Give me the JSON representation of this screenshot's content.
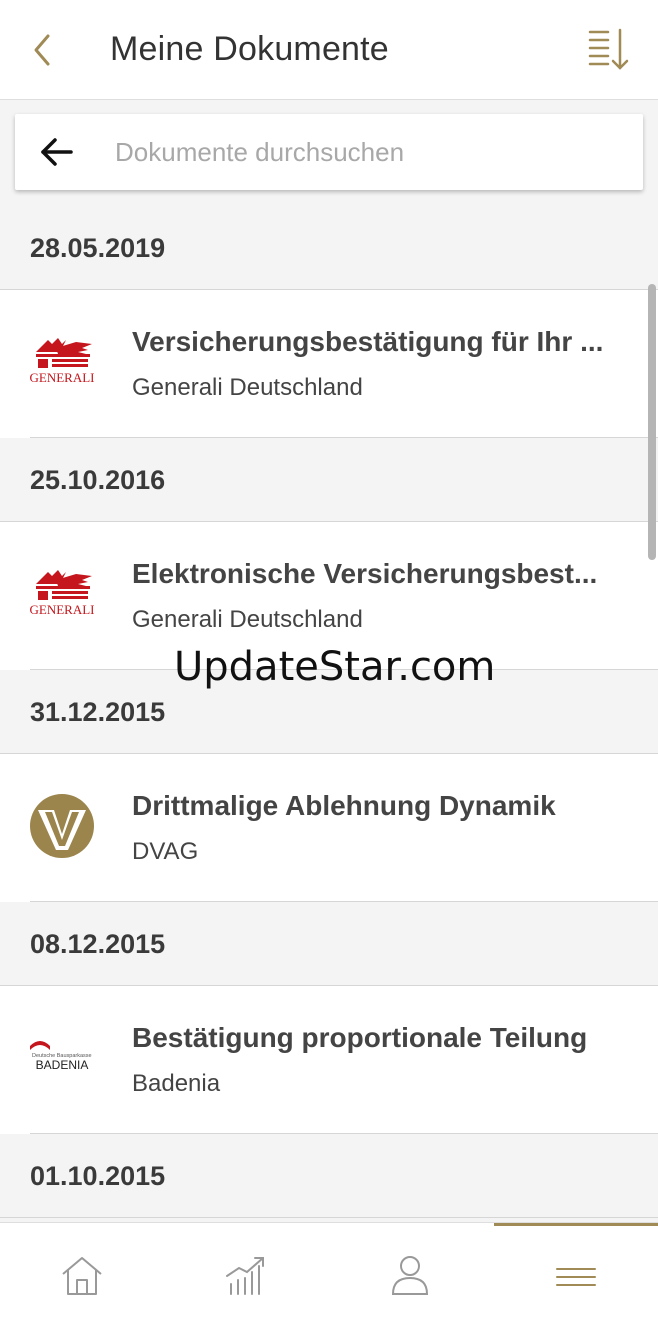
{
  "header": {
    "title": "Meine Dokumente",
    "back_icon": "chevron-left-icon",
    "sort_icon": "sort-list-icon"
  },
  "search": {
    "placeholder": "Dokumente durchsuchen",
    "value": "",
    "back_icon": "arrow-left-icon"
  },
  "colors": {
    "accent": "#a08a55",
    "generali_red": "#c4161c",
    "dvag_gold": "#9b854c",
    "text": "#333333",
    "background": "#f4f4f4"
  },
  "groups": [
    {
      "date": "28.05.2019",
      "items": [
        {
          "title": "Versicherungsbestätigung für Ihr ...",
          "subtitle": "Generali Deutschland",
          "logo": "generali-logo",
          "logo_text": "GENERALI"
        }
      ]
    },
    {
      "date": "25.10.2016",
      "items": [
        {
          "title": "Elektronische Versicherungsbest...",
          "subtitle": "Generali Deutschland",
          "logo": "generali-logo",
          "logo_text": "GENERALI"
        }
      ]
    },
    {
      "date": "31.12.2015",
      "items": [
        {
          "title": "Drittmalige Ablehnung Dynamik",
          "subtitle": "DVAG",
          "logo": "dvag-logo"
        }
      ]
    },
    {
      "date": "08.12.2015",
      "items": [
        {
          "title": "Bestätigung proportionale Teilung",
          "subtitle": "Badenia",
          "logo": "badenia-logo",
          "logo_text": "BADENIA",
          "logo_subtext": "Deutsche Bausparkasse"
        }
      ]
    },
    {
      "date": "01.10.2015",
      "items": []
    }
  ],
  "watermark": "UpdateStar.com",
  "tabs": [
    {
      "name": "home",
      "icon": "home-icon",
      "active": false
    },
    {
      "name": "finance",
      "icon": "chart-icon",
      "active": false
    },
    {
      "name": "profile",
      "icon": "user-icon",
      "active": false
    },
    {
      "name": "menu",
      "icon": "menu-icon",
      "active": true
    }
  ]
}
